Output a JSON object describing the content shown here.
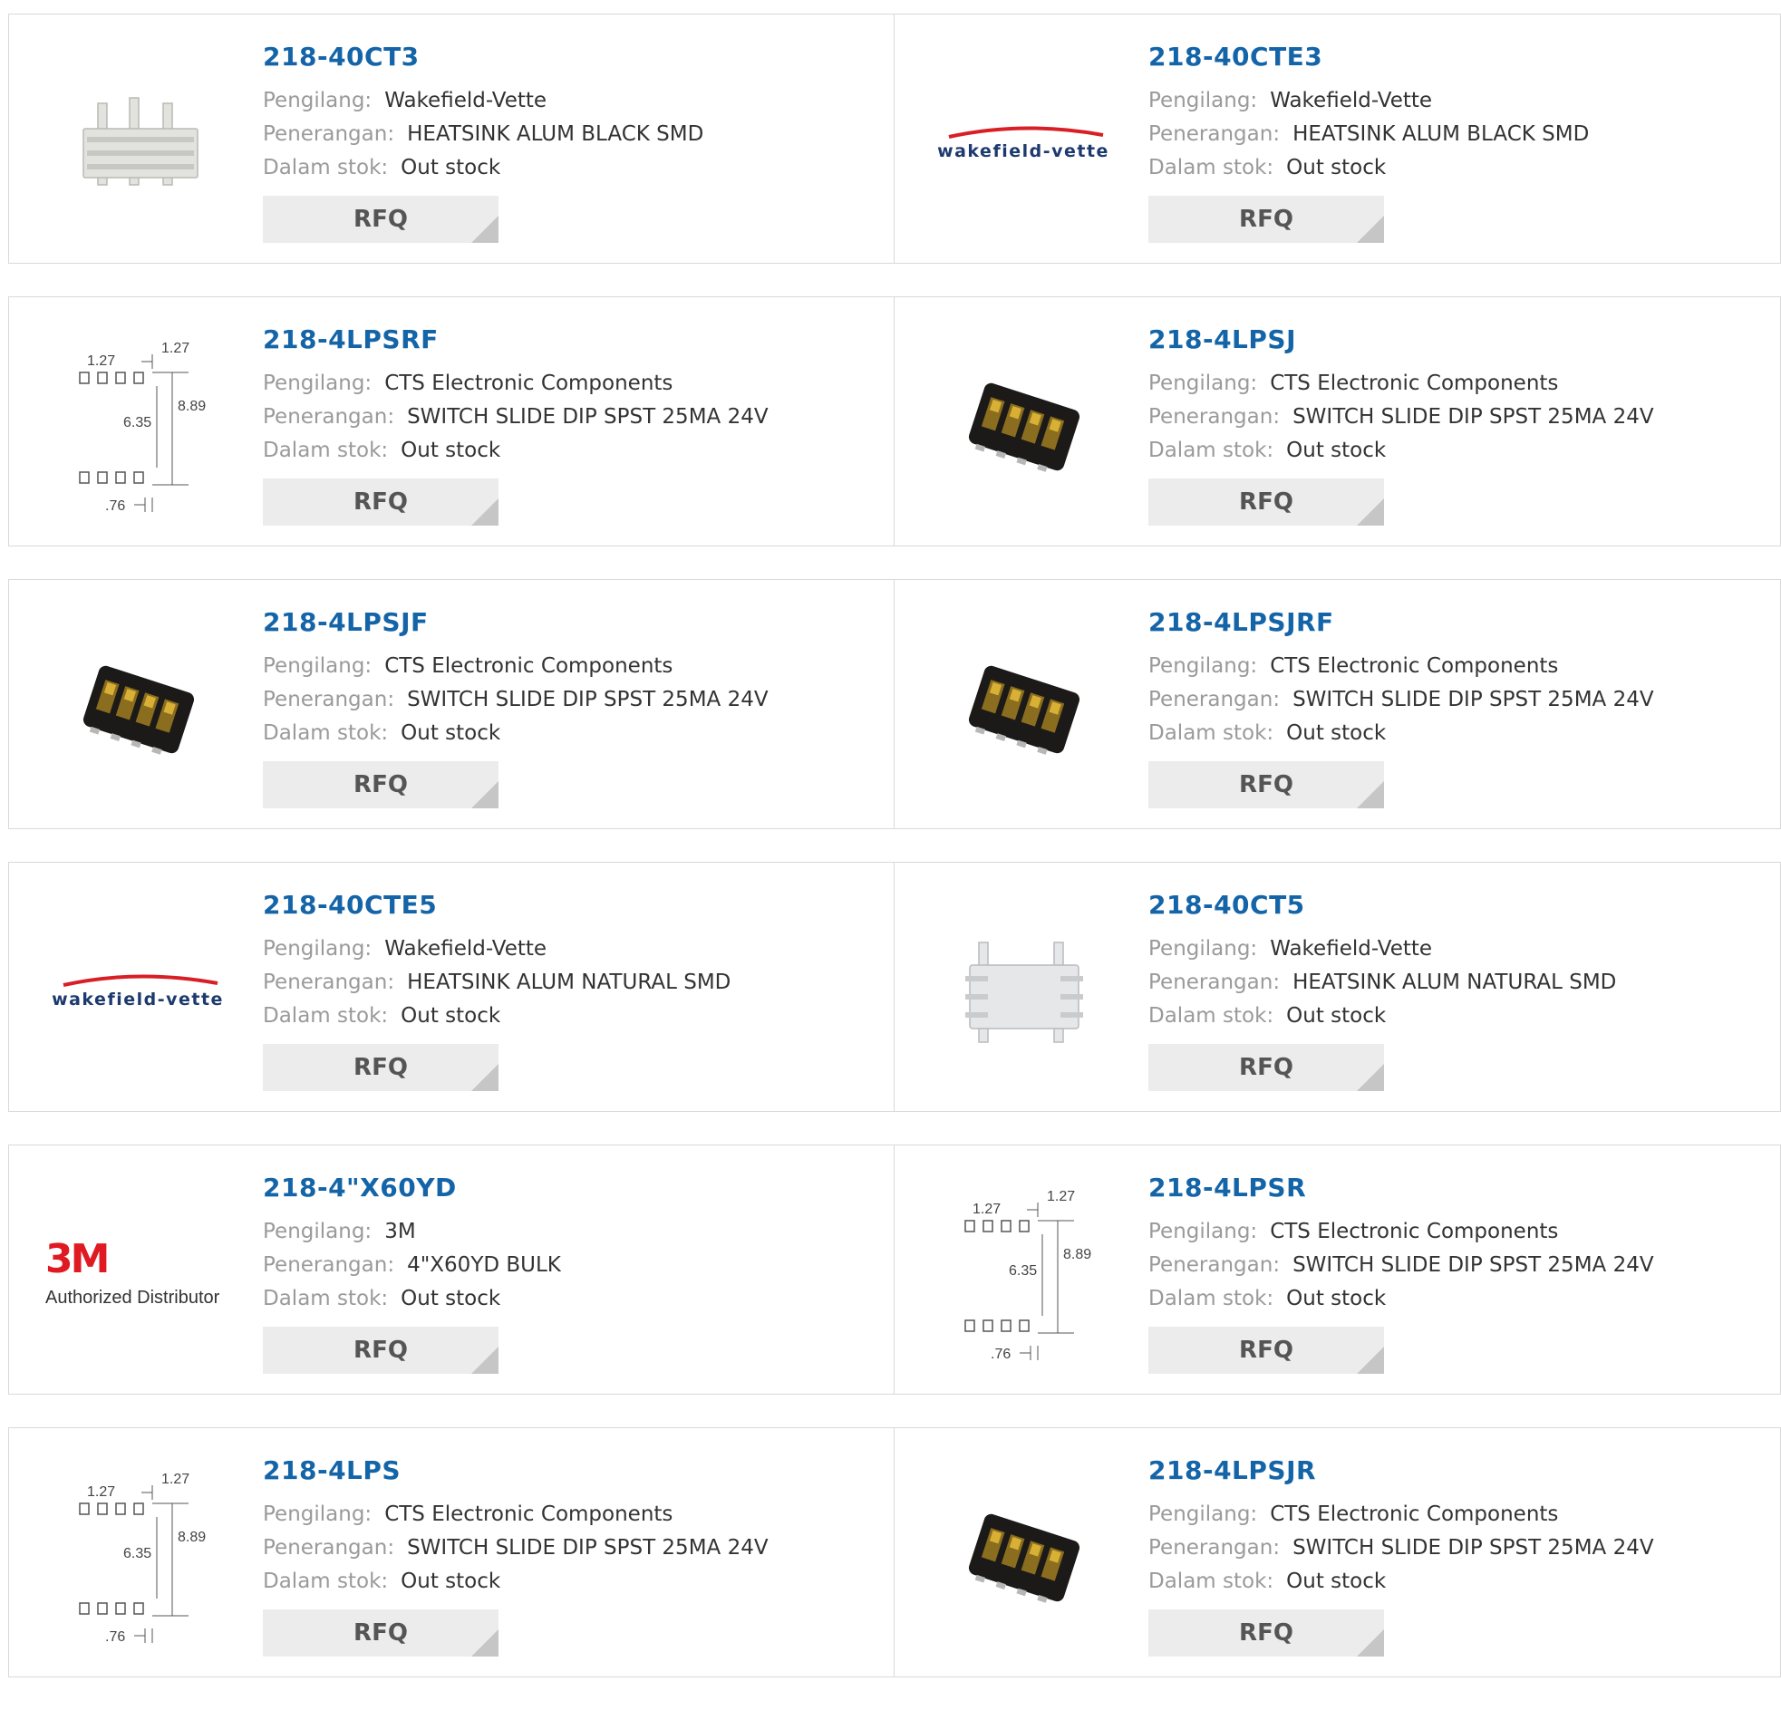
{
  "labels": {
    "manufacturer": "Pengilang:",
    "description": "Penerangan:",
    "stock": "Dalam stok:",
    "rfq": "RFQ"
  },
  "image_text": {
    "wakefield_logo": "wakefield-vette",
    "threem_logo": "3M",
    "threem_tagline": "Authorized Distributor",
    "dim_pitch_a": "1.27",
    "dim_pitch_b": "1.27",
    "dim_height": "8.89",
    "dim_inner": "6.35",
    "dim_pad": ".76"
  },
  "colors": {
    "part_link": "#1464a8",
    "label": "#9a9a9a",
    "value": "#333333",
    "rfq_bg": "#ececec",
    "wakefield_text": "#1d3a6e",
    "wakefield_swoosh": "#d81f26",
    "threem_red": "#e01a22"
  },
  "products": [
    {
      "part": "218-40CT3",
      "manufacturer": "Wakefield-Vette",
      "description": "HEATSINK ALUM BLACK SMD",
      "stock": "Out stock",
      "image": "heatsink-black"
    },
    {
      "part": "218-40CTE3",
      "manufacturer": "Wakefield-Vette",
      "description": "HEATSINK ALUM BLACK SMD",
      "stock": "Out stock",
      "image": "wakefield-logo"
    },
    {
      "part": "218-4LPSRF",
      "manufacturer": "CTS Electronic Components",
      "description": "SWITCH SLIDE DIP SPST 25MA 24V",
      "stock": "Out stock",
      "image": "dip-diagram"
    },
    {
      "part": "218-4LPSJ",
      "manufacturer": "CTS Electronic Components",
      "description": "SWITCH SLIDE DIP SPST 25MA 24V",
      "stock": "Out stock",
      "image": "dip-switch"
    },
    {
      "part": "218-4LPSJF",
      "manufacturer": "CTS Electronic Components",
      "description": "SWITCH SLIDE DIP SPST 25MA 24V",
      "stock": "Out stock",
      "image": "dip-switch"
    },
    {
      "part": "218-4LPSJRF",
      "manufacturer": "CTS Electronic Components",
      "description": "SWITCH SLIDE DIP SPST 25MA 24V",
      "stock": "Out stock",
      "image": "dip-switch"
    },
    {
      "part": "218-40CTE5",
      "manufacturer": "Wakefield-Vette",
      "description": "HEATSINK ALUM NATURAL SMD",
      "stock": "Out stock",
      "image": "wakefield-logo"
    },
    {
      "part": "218-40CT5",
      "manufacturer": "Wakefield-Vette",
      "description": "HEATSINK ALUM NATURAL SMD",
      "stock": "Out stock",
      "image": "heatsink-natural"
    },
    {
      "part": "218-4\"X60YD",
      "manufacturer": "3M",
      "description": "4\"X60YD BULK",
      "stock": "Out stock",
      "image": "threem-logo"
    },
    {
      "part": "218-4LPSR",
      "manufacturer": "CTS Electronic Components",
      "description": "SWITCH SLIDE DIP SPST 25MA 24V",
      "stock": "Out stock",
      "image": "dip-diagram"
    },
    {
      "part": "218-4LPS",
      "manufacturer": "CTS Electronic Components",
      "description": "SWITCH SLIDE DIP SPST 25MA 24V",
      "stock": "Out stock",
      "image": "dip-diagram"
    },
    {
      "part": "218-4LPSJR",
      "manufacturer": "CTS Electronic Components",
      "description": "SWITCH SLIDE DIP SPST 25MA 24V",
      "stock": "Out stock",
      "image": "dip-switch"
    }
  ]
}
